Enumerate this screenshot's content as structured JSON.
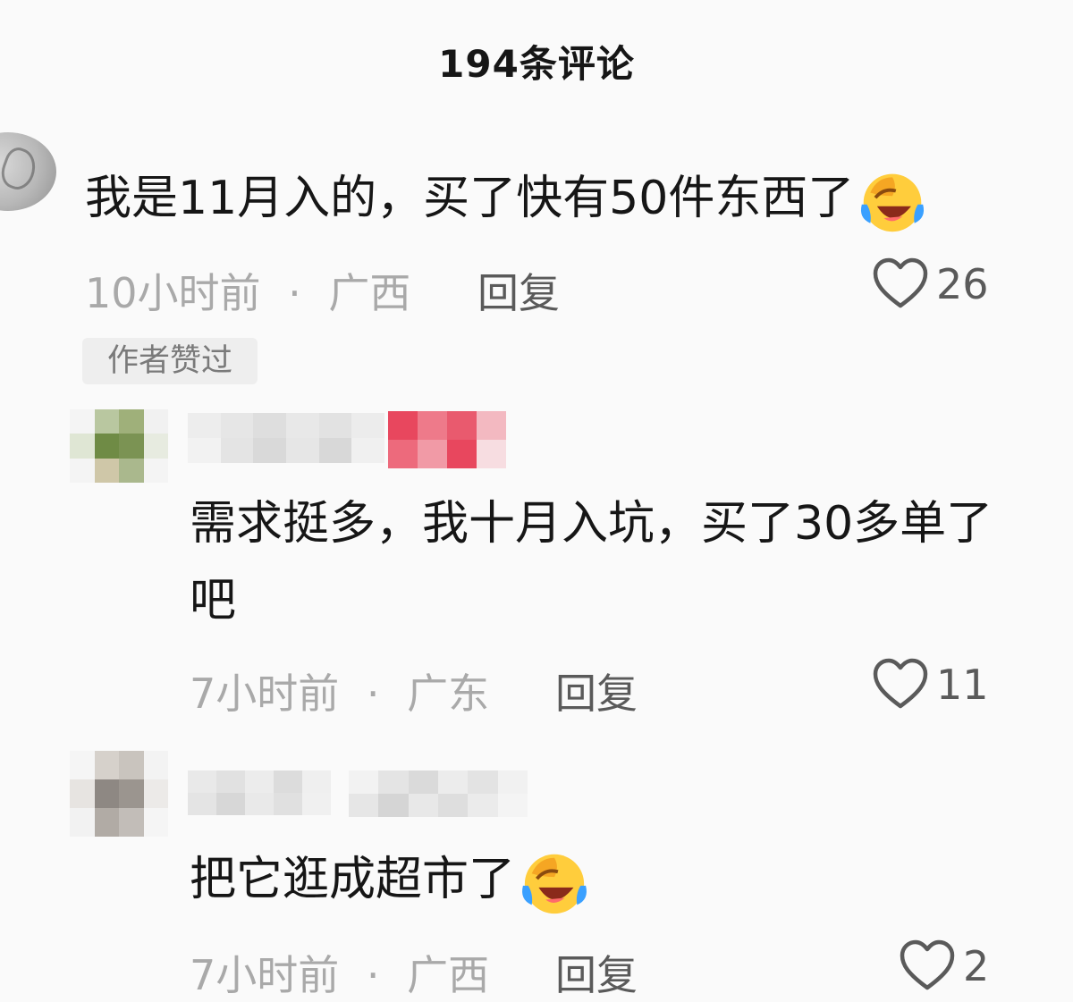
{
  "header": {
    "title": "194条评论"
  },
  "comments": [
    {
      "text": "我是11月入的，买了快有50件东西了",
      "emoji": "laughing-crying-emoji",
      "time": "10小时前",
      "separator": "·",
      "location": "广西",
      "reply_label": "回复",
      "likes": "26",
      "badge": "作者赞过"
    },
    {
      "text_line1": "需求挺多，我十月入坑，买了30多单了",
      "text_line2": "吧",
      "time": "7小时前",
      "separator": "·",
      "location": "广东",
      "reply_label": "回复",
      "likes": "11"
    },
    {
      "text": "把它逛成超市了",
      "emoji": "laughing-crying-emoji",
      "time": "7小时前",
      "separator": "·",
      "location": "广西",
      "reply_label": "回复",
      "likes": "2"
    }
  ],
  "colors": {
    "background": "#fafafa",
    "text": "#161616",
    "meta": "#a9a9a9",
    "badge_bg": "#eeeeee",
    "blur_pink": "#e8475e"
  },
  "icons": [
    "heart-outline-icon",
    "laughing-crying-emoji"
  ]
}
